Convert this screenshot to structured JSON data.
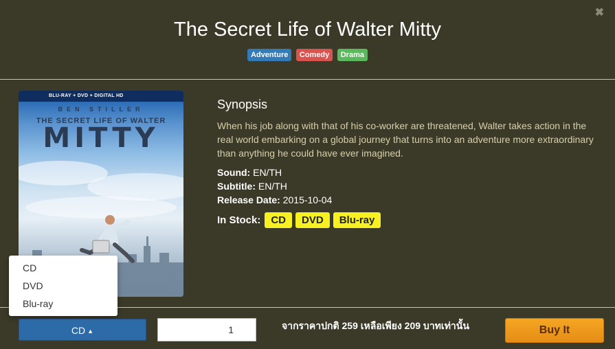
{
  "modal": {
    "title": "The Secret Life of Walter Mitty",
    "close_icon": "close-icon",
    "genres": [
      {
        "label": "Adventure",
        "color": "#337ab7"
      },
      {
        "label": "Comedy",
        "color": "#d9534f"
      },
      {
        "label": "Drama",
        "color": "#5cb85c"
      }
    ]
  },
  "poster": {
    "formats_strip": "BLU-RAY + DVD + DIGITAL HD",
    "actor": "BEN STILLER",
    "subtitle": "THE SECRET LIFE OF WALTER",
    "big_title": "MITTY"
  },
  "synopsis": {
    "heading": "Synopsis",
    "text": "When his job along with that of his co-worker are threatened, Walter takes action in the real world embarking on a global journey that turns into an adventure more extraordinary than anything he could have ever imagined.",
    "sound_label": "Sound:",
    "sound": "EN/TH",
    "subtitle_label": "Subtitle:",
    "subtitle": "EN/TH",
    "release_label": "Release Date:",
    "release": "2015-10-04",
    "stock_label": "In Stock:",
    "stock": [
      "CD",
      "DVD",
      "Blu-ray"
    ],
    "stock_color": "#f7f022"
  },
  "dropdown": {
    "options": [
      "CD",
      "DVD",
      "Blu-ray"
    ],
    "selected": "CD",
    "caret_icon": "caret-up-icon"
  },
  "order": {
    "quantity": "1",
    "price_text": "จากราคาปกติ 259 เหลือเพียง 209 บาทเท่านั้น",
    "buy_label": "Buy It",
    "buy_color": "#f0a02a"
  }
}
